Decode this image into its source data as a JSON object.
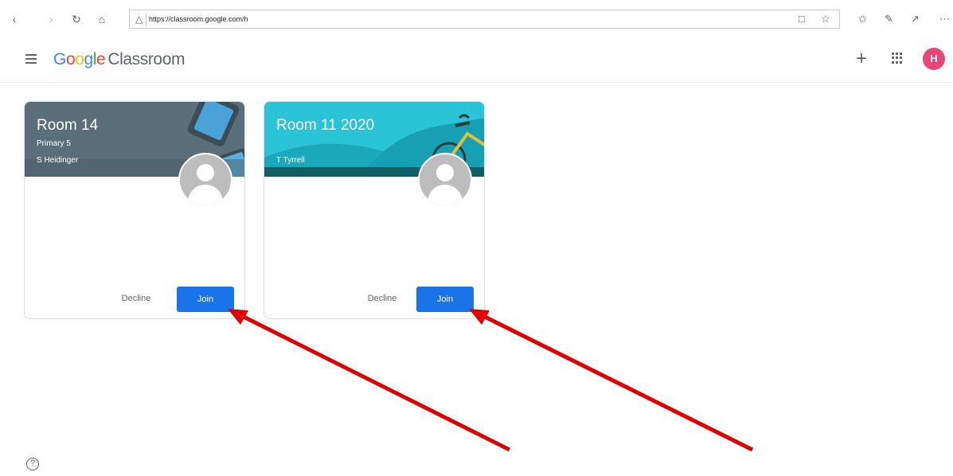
{
  "browser": {
    "url": "https://classroom.google.com/h",
    "back_icon": "chevron-left-icon",
    "forward_icon": "chevron-right-icon",
    "refresh_icon": "refresh-icon",
    "home_icon": "home-icon",
    "lock_icon": "lock-icon"
  },
  "header": {
    "logo_letters": [
      "G",
      "o",
      "o",
      "g",
      "l",
      "e"
    ],
    "product": "Classroom",
    "avatar_letter": "H"
  },
  "cards": [
    {
      "title": "Room 14",
      "section": "Primary 5",
      "teacher": "S Heidinger",
      "decline_label": "Decline",
      "join_label": "Join",
      "banner_color": "#5b6f7b"
    },
    {
      "title": "Room 11 2020",
      "section": "",
      "teacher": "T Tyrrell",
      "decline_label": "Decline",
      "join_label": "Join",
      "banner_color": "#2ac4d6"
    }
  ],
  "colors": {
    "join_button": "#1a73e8",
    "arrow": "#e00000",
    "avatar": "#e8457a"
  }
}
